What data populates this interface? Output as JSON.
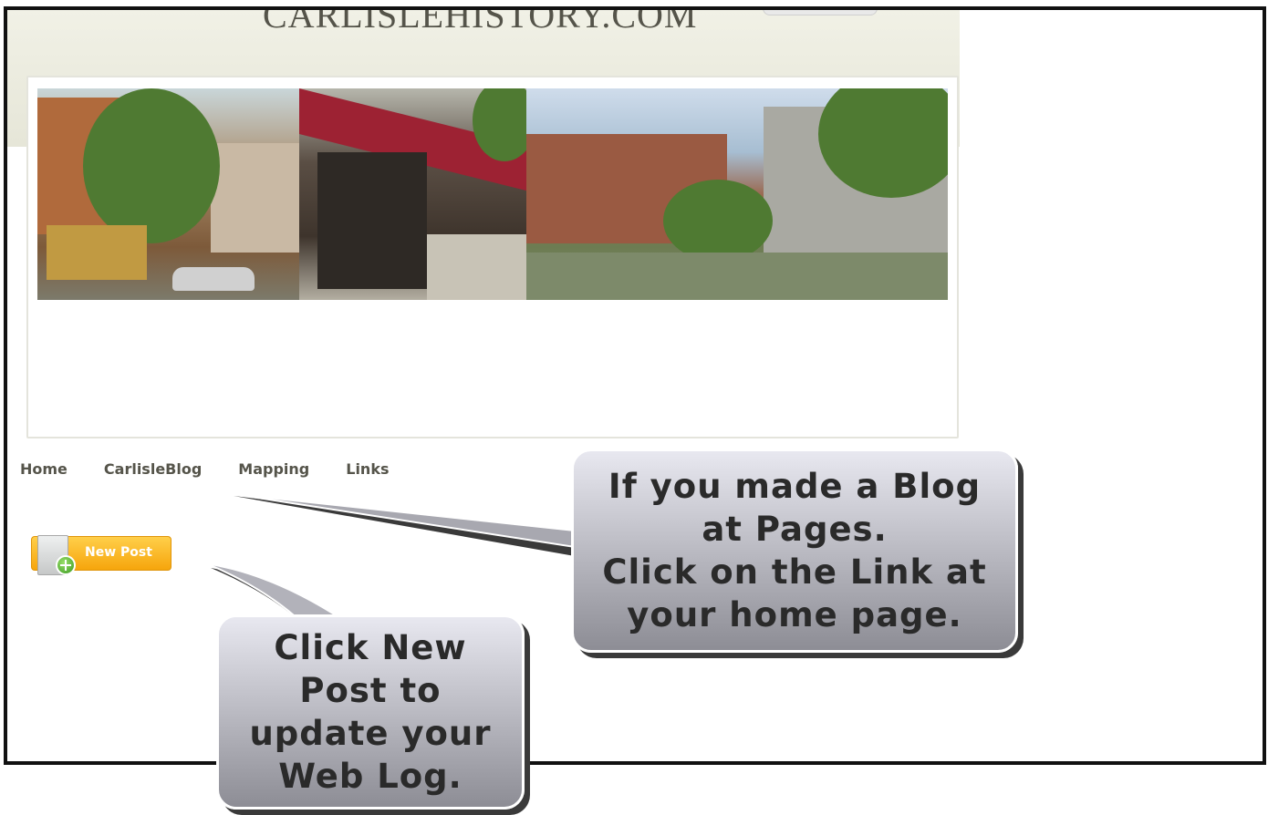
{
  "header": {
    "site_title": "CARLISLEHISTORY.COM"
  },
  "nav": {
    "items": [
      {
        "label": "Home"
      },
      {
        "label": "CarlisleBlog"
      },
      {
        "label": "Mapping"
      },
      {
        "label": "Links"
      }
    ]
  },
  "actions": {
    "new_post_label": "New Post"
  },
  "callouts": {
    "blog_link": "If you made a Blog\nat Pages.\nClick on the Link at\nyour home page.",
    "new_post": "Click New\nPost to\nupdate your\nWeb Log."
  },
  "colors": {
    "callout_fill": "#a8a8b0",
    "callout_shadow": "#3a3a3a",
    "new_post_button": "#f6a50c",
    "nav_text": "#55544a",
    "frame_border": "#111111"
  },
  "icons": {
    "new_post": "document-plus-icon"
  }
}
